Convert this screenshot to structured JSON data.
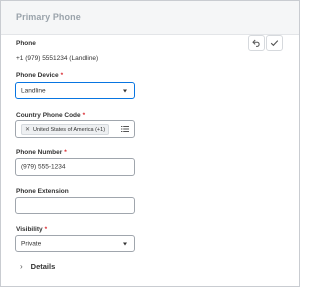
{
  "card": {
    "title": "Primary Phone"
  },
  "actions": {
    "cancel_icon": "undo-arrow-icon",
    "save_icon": "checkmark-icon"
  },
  "phone": {
    "label": "Phone",
    "value": "+1 (979) 5551234 (Landline)"
  },
  "phone_device": {
    "label": "Phone Device",
    "required": "*",
    "value": "Landline"
  },
  "country_code": {
    "label": "Country Phone Code",
    "required": "*",
    "selected_pill": "United States of America (+1)"
  },
  "phone_number": {
    "label": "Phone Number",
    "required": "*",
    "value": "(979) 555-1234"
  },
  "phone_extension": {
    "label": "Phone Extension",
    "value": ""
  },
  "visibility": {
    "label": "Visibility",
    "required": "*",
    "value": "Private"
  },
  "details": {
    "label": "Details"
  },
  "colors": {
    "accent": "#0875e1",
    "required": "#d9272e",
    "header_bg": "#f5f6f7",
    "header_text": "#9aa3ab"
  }
}
